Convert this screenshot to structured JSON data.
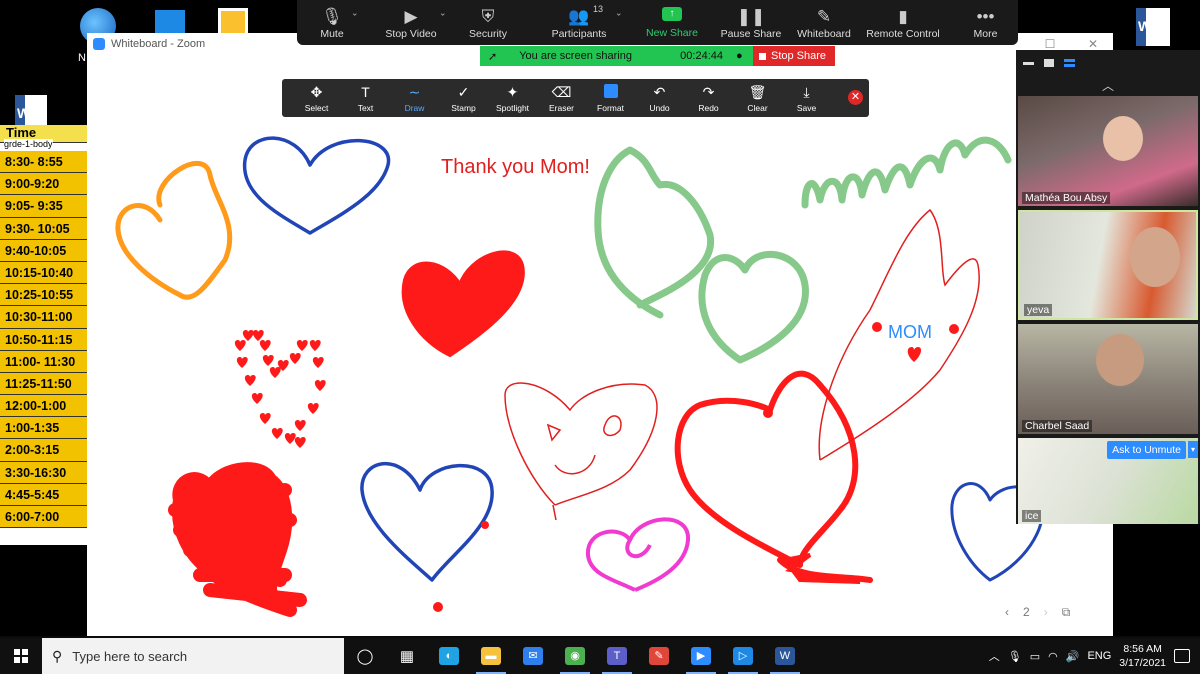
{
  "meeting_bar": {
    "items": [
      {
        "label": "Mute",
        "icon": "microphone-icon",
        "caret": true
      },
      {
        "label": "Stop Video",
        "icon": "video-camera-icon",
        "caret": true
      },
      {
        "label": "Security",
        "icon": "shield-icon",
        "caret": false
      },
      {
        "label": "Participants",
        "icon": "participants-icon",
        "caret": true,
        "count": "13"
      },
      {
        "label": "New Share",
        "icon": "share-arrow-icon",
        "caret": false
      },
      {
        "label": "Pause Share",
        "icon": "pause-icon",
        "caret": false
      },
      {
        "label": "Whiteboard",
        "icon": "pen-icon",
        "caret": false
      },
      {
        "label": "Remote Control",
        "icon": "mouse-icon",
        "caret": false
      },
      {
        "label": "More",
        "icon": "more-dots-icon",
        "caret": false
      }
    ]
  },
  "share_banner": {
    "text": "You are screen sharing",
    "timer": "00:24:44",
    "stop_label": "Stop Share"
  },
  "whiteboard_window": {
    "title": "Whiteboard - Zoom",
    "tools": [
      {
        "label": "Select",
        "icon": "move-icon"
      },
      {
        "label": "Text",
        "icon": "text-icon"
      },
      {
        "label": "Draw",
        "icon": "draw-icon",
        "active": true
      },
      {
        "label": "Stamp",
        "icon": "stamp-icon"
      },
      {
        "label": "Spotlight",
        "icon": "spotlight-icon"
      },
      {
        "label": "Eraser",
        "icon": "eraser-icon"
      },
      {
        "label": "Format",
        "icon": "format-icon"
      },
      {
        "label": "Undo",
        "icon": "undo-icon"
      },
      {
        "label": "Redo",
        "icon": "redo-icon"
      },
      {
        "label": "Clear",
        "icon": "trash-icon"
      },
      {
        "label": "Save",
        "icon": "save-icon"
      }
    ],
    "canvas_text": {
      "thank_you": "Thank you Mom!",
      "mom": "MOM"
    },
    "page_number": "2",
    "colors": {
      "red": "#ff1a1a",
      "blue": "#2145b6",
      "green": "#86c98a",
      "orange": "#ff9a1a",
      "pink": "#f03ad0"
    }
  },
  "schedule_sheet": {
    "header": "Time",
    "subheader": "grde-1-body",
    "rows": [
      "8:30- 8:55",
      "9:00-9:20",
      "9:05- 9:35",
      "9:30- 10:05",
      "9:40-10:05",
      "10:15-10:40",
      "10:25-10:55",
      "10:30-11:00",
      "10:50-11:15",
      "11:00- 11:30",
      "11:25-11:50",
      "12:00-1:00",
      "1:00-1:35",
      "2:00-3:15",
      "3:30-16:30",
      "4:45-5:45",
      "6:00-7:00"
    ]
  },
  "desktop": {
    "partial_label": "N"
  },
  "participants_panel": {
    "tiles": [
      {
        "name": "Mathéa Bou Absy"
      },
      {
        "name": "yeva"
      },
      {
        "name": "Charbel Saad"
      },
      {
        "name": "ice"
      }
    ],
    "ask_unmute_label": "Ask to Unmute"
  },
  "taskbar": {
    "search_placeholder": "Type here to search",
    "apps": [
      "task-view-icon",
      "widgets-icon",
      "edge-icon",
      "file-explorer-icon",
      "mail-icon",
      "chrome-icon",
      "teams-icon",
      "paint-icon",
      "zoom-icon",
      "media-player-icon",
      "word-icon"
    ],
    "language": "ENG",
    "time": "8:56 AM",
    "date": "3/17/2021"
  }
}
